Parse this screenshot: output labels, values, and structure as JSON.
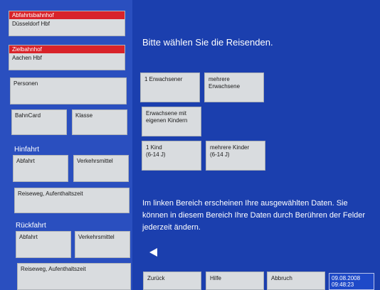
{
  "sidebar": {
    "departure_station": {
      "label": "Abfahrtsbahnhof",
      "value": "Düsseldorf Hbf"
    },
    "destination_station": {
      "label": "Zielbahnhof",
      "value": "Aachen Hbf"
    },
    "persons_label": "Personen",
    "bahncard_label": "BahnCard",
    "class_label": "Klasse",
    "outbound": {
      "title": "Hinfahrt",
      "departure_label": "Abfahrt",
      "transport_label": "Verkehrsmittel",
      "route_label": "Reiseweg, Aufenthaltszeit"
    },
    "return": {
      "title": "Rückfahrt",
      "departure_label": "Abfahrt",
      "transport_label": "Verkehrsmittel",
      "route_label": "Reiseweg, Aufenthaltszeit"
    }
  },
  "main": {
    "heading": "Bitte wählen Sie die Reisenden.",
    "options": [
      {
        "line1": "1 Erwachsener",
        "line2": ""
      },
      {
        "line1": "mehrere",
        "line2": "Erwachsene"
      },
      {
        "line1": "Erwachsene mit",
        "line2": "eigenen Kindern"
      },
      {
        "line1": "1 Kind",
        "line2": "(6-14 J)"
      },
      {
        "line1": "mehrere Kinder",
        "line2": "(6-14 J)"
      }
    ],
    "info_text": "Im linken Bereich erscheinen Ihre ausgewählten Daten. Sie können in diesem Bereich Ihre Daten durch Berühren der Felder jederzeit ändern."
  },
  "footer": {
    "back_label": "Zurück",
    "help_label": "Hilfe",
    "cancel_label": "Abbruch",
    "date": "09.08.2008",
    "time": "09:48:23"
  },
  "colors": {
    "background": "#1b3fae",
    "header_red": "#d8232a",
    "button_gray": "#d9dcdf"
  }
}
